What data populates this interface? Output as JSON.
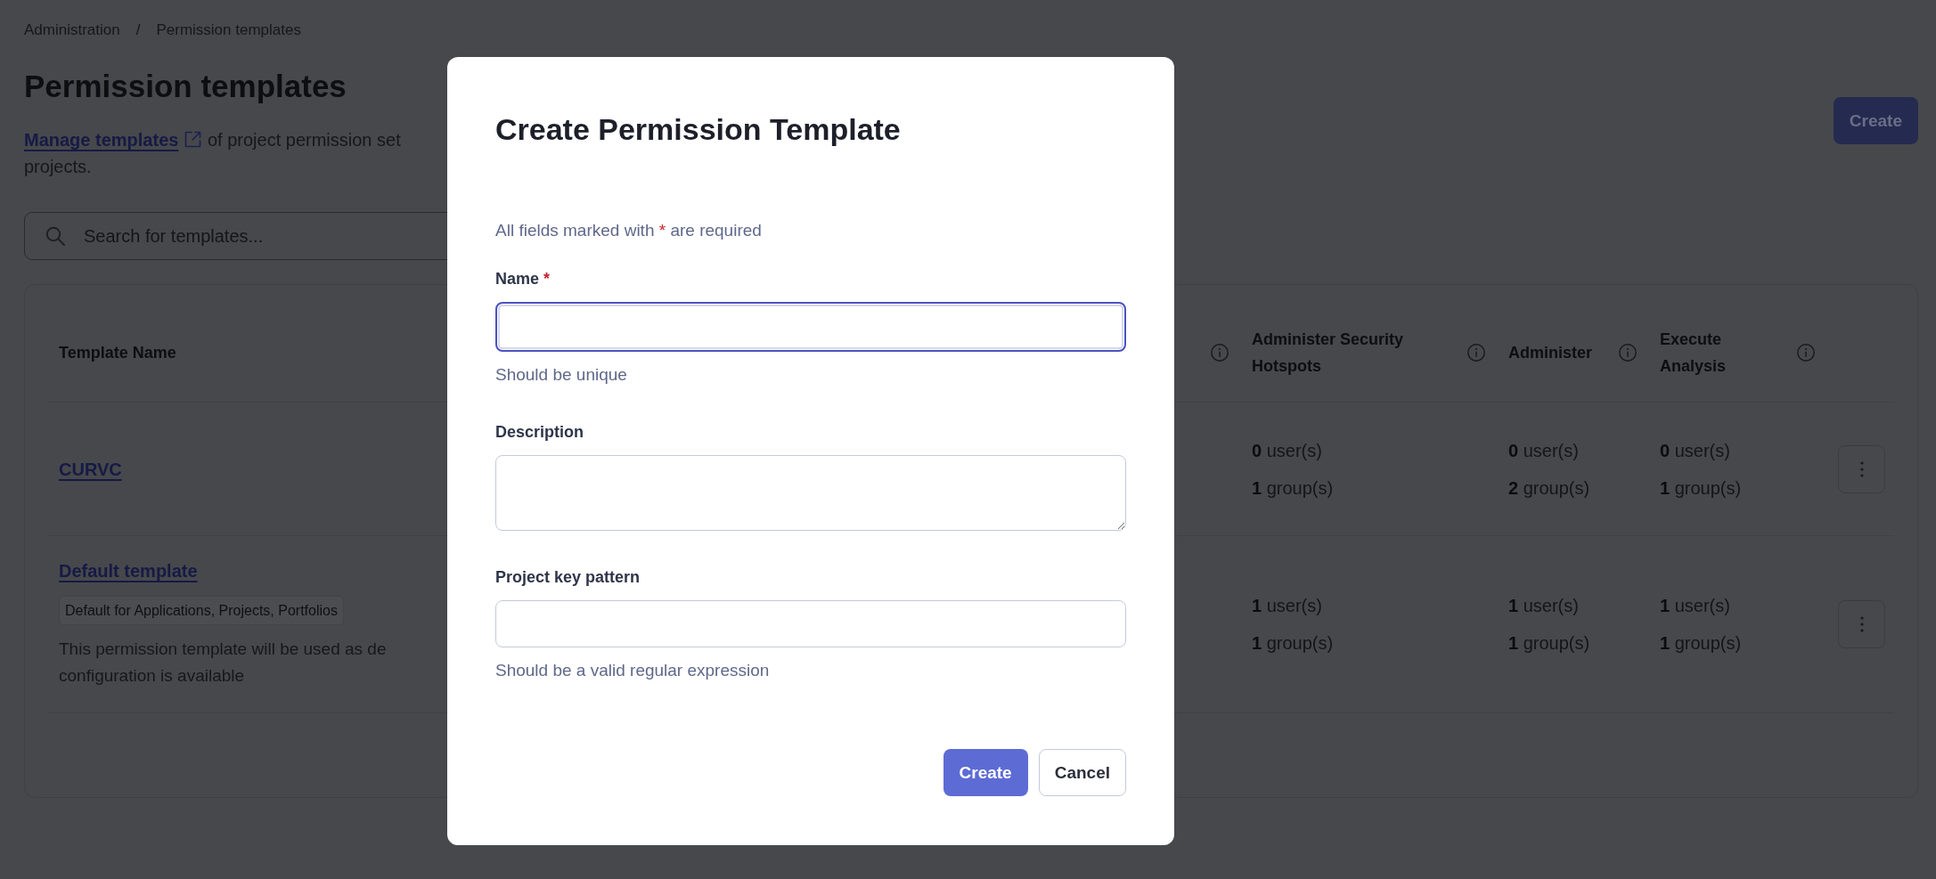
{
  "breadcrumbs": {
    "items": [
      "Administration",
      "Permission templates"
    ],
    "separator": "/"
  },
  "page": {
    "title": "Permission templates",
    "description": {
      "link": "Manage templates",
      "text": [
        "of project permission set",
        "projects."
      ]
    },
    "create_button": "Create"
  },
  "search": {
    "placeholder": "Search for templates..."
  },
  "table": {
    "columns": [
      {
        "label": "Template Name",
        "info": false
      },
      {
        "info": true
      },
      {
        "label": "Administer Security Hotspots",
        "info": true
      },
      {
        "label": "Administer",
        "info": true
      },
      {
        "label": "Execute Analysis",
        "info": true
      }
    ],
    "rows": [
      {
        "cells": [
          {
            "kind": "template",
            "name": "CURVC"
          },
          "",
          {
            "kind": "counts",
            "users": "**0** user(s)",
            "groups": "**1** group(s)"
          },
          {
            "kind": "counts",
            "users": "**0** user(s)",
            "groups": "**2** group(s)"
          },
          {
            "kind": "counts",
            "users": "**0** user(s)",
            "groups": "**1** group(s)"
          }
        ]
      },
      {
        "cells": [
          {
            "kind": "template",
            "name": "Default template",
            "tag": "Default for Applications, Projects, Portfolios",
            "description": [
              "This permission template will be used as de",
              "configuration is available"
            ]
          },
          "",
          {
            "kind": "counts",
            "users": "**1** user(s)",
            "groups": "**1** group(s)"
          },
          {
            "kind": "counts",
            "users": "**1** user(s)",
            "groups": "**1** group(s)"
          },
          {
            "kind": "counts",
            "users": "**1** user(s)",
            "groups": "**1** group(s)"
          }
        ]
      }
    ]
  },
  "modal": {
    "title": "Create Permission Template",
    "required_note": {
      "before": "All fields marked with",
      "mark": "*",
      "after": "are required"
    },
    "fields": [
      {
        "kind": "input",
        "label": "Name",
        "required_mark": "*",
        "focused": true,
        "hint": "Should be unique"
      },
      {
        "kind": "textarea",
        "label": "Description",
        "focused": false
      },
      {
        "kind": "input",
        "label": "Project key pattern",
        "focused": false,
        "hint": "Should be a valid regular expression"
      }
    ],
    "buttons": [
      {
        "label": "Create",
        "kind": "primary"
      },
      {
        "label": "Cancel",
        "kind": "secondary"
      }
    ]
  }
}
